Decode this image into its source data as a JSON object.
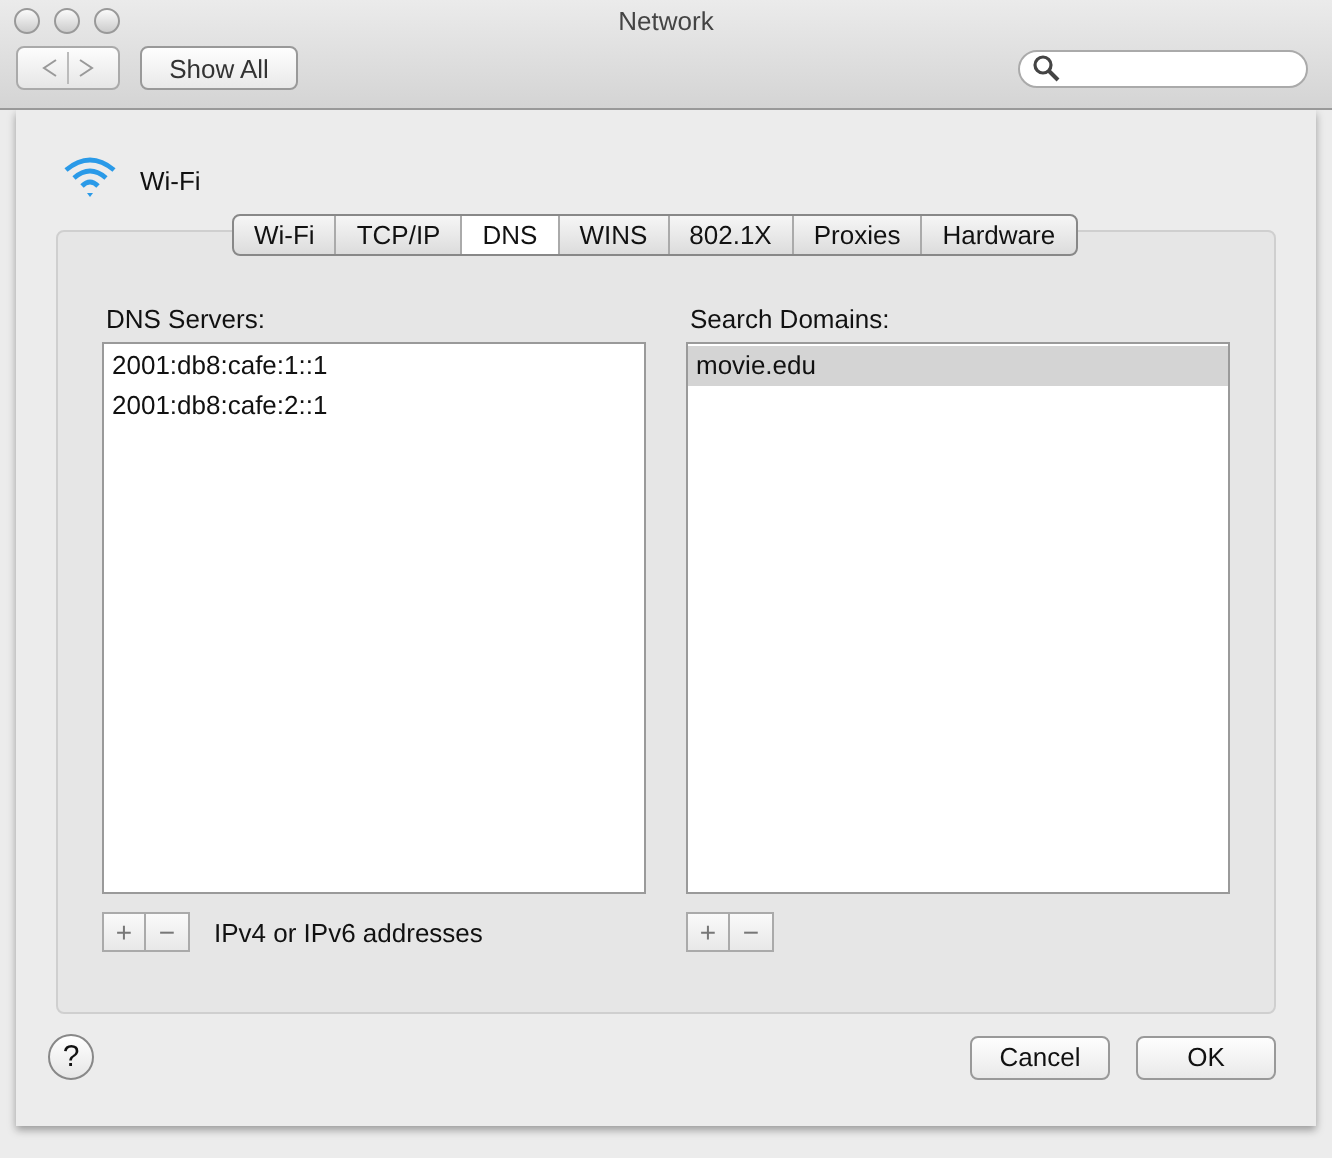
{
  "window": {
    "title": "Network"
  },
  "toolbar": {
    "show_all": "Show All"
  },
  "service": {
    "name": "Wi-Fi"
  },
  "tabs": [
    {
      "label": "Wi-Fi",
      "selected": false
    },
    {
      "label": "TCP/IP",
      "selected": false
    },
    {
      "label": "DNS",
      "selected": true
    },
    {
      "label": "WINS",
      "selected": false
    },
    {
      "label": "802.1X",
      "selected": false
    },
    {
      "label": "Proxies",
      "selected": false
    },
    {
      "label": "Hardware",
      "selected": false
    }
  ],
  "lists": [
    {
      "title": "DNS Servers:",
      "hint": "IPv4 or IPv6 addresses",
      "items": [
        {
          "text": "2001:db8:cafe:1::1",
          "selected": false
        },
        {
          "text": "2001:db8:cafe:2::1",
          "selected": false
        }
      ]
    },
    {
      "title": "Search Domains:",
      "items": [
        {
          "text": "movie.edu",
          "selected": true
        }
      ]
    }
  ],
  "buttons": {
    "add": "+",
    "remove": "−",
    "help": "?",
    "cancel": "Cancel",
    "ok": "OK"
  }
}
